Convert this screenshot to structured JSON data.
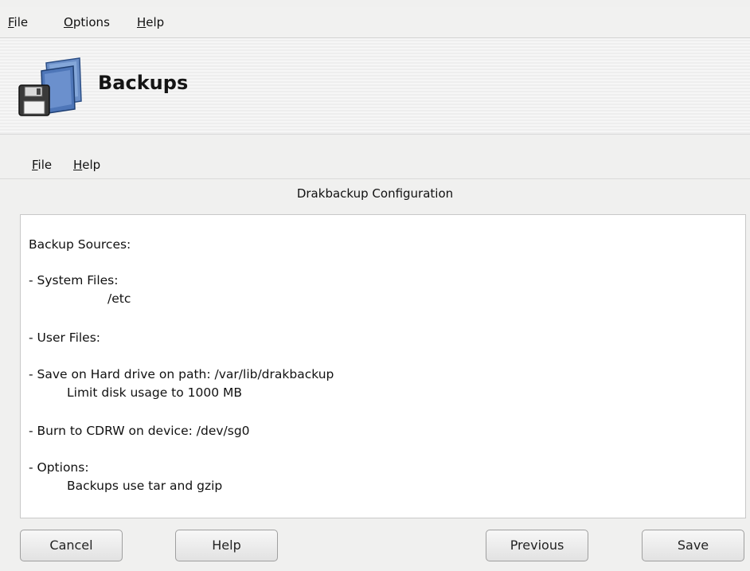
{
  "menubar": {
    "file": {
      "accel": "F",
      "rest": "ile"
    },
    "options": {
      "accel": "O",
      "rest": "ptions"
    },
    "help": {
      "accel": "H",
      "rest": "elp"
    }
  },
  "banner": {
    "title": "Backups",
    "icon": "backup-folder-floppy-icon"
  },
  "submenu": {
    "file": {
      "accel": "F",
      "rest": "ile"
    },
    "help": {
      "accel": "H",
      "rest": "elp"
    }
  },
  "dialog_title": "Drakbackup Configuration",
  "summary": {
    "sources_heading": "Backup Sources:",
    "system_files": "- System Files:",
    "system_path": "/etc",
    "user_files": "- User Files:",
    "hard_drive": "- Save on Hard drive on path: /var/lib/drakbackup",
    "limit": "Limit disk usage to 1000 MB",
    "cdrw": "- Burn to CDRW on device: /dev/sg0",
    "options": "- Options:",
    "tar": "Backups use tar and gzip"
  },
  "buttons": {
    "cancel": "Cancel",
    "help": "Help",
    "previous": "Previous",
    "save": "Save"
  }
}
